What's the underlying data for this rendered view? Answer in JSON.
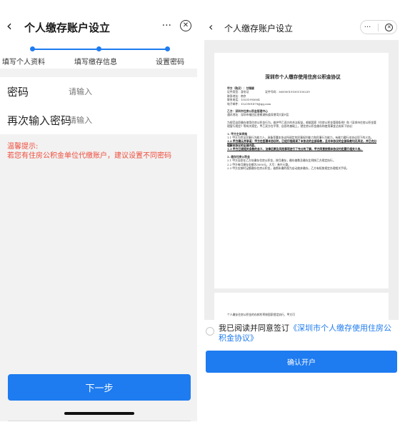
{
  "left": {
    "nav": {
      "back_icon": "‹",
      "title": "个人缴存账户设立",
      "more_icon": "···",
      "close_icon": "✕"
    },
    "steps": [
      "填写个人资料",
      "填写缴存信息",
      "设置密码"
    ],
    "fields": [
      {
        "label": "密码",
        "placeholder": "请输入"
      },
      {
        "label": "再次输入密码",
        "placeholder": "请输入"
      }
    ],
    "tips": {
      "title": "温馨提示:",
      "body": "若您有住房公积金单位代缴账户，建议设置不同密码"
    },
    "next_button": "下一步",
    "colors": {
      "accent": "#1e7bf0",
      "warning": "#ee4d3c"
    }
  },
  "right": {
    "nav": {
      "back_icon": "‹",
      "title": "个人缴存账户设立",
      "more_icon": "···",
      "close_icon": "✕"
    },
    "document": {
      "title": "深圳市个人缴存使用住房公积金协议",
      "party_a": [
        "甲方（购买）：甘精颖",
        "证件类型：身份证　　　　　　证件号码：360000191001150239",
        "联系地址：南京",
        "联系电话：15531993604",
        "电子邮件：1523901879@qq.com"
      ],
      "party_b": [
        "乙方：深圳市住房公积金管理中心",
        "通讯地址：深圳市福田区香蜜湖街道深港湾大厦F层"
      ],
      "intro": "为规范自愿缴存使用住房公积金行为，维护甲乙双方的合法权益，根据国家《住房公积金管理条例》和《深圳市住房公积金管理暂行规定》等有关规定，甲乙双方在平等、自愿的基础上，就住房公积金缴存和使用事宜达成如下协议：",
      "section1": "1. 甲方主体资格",
      "s1_1": "1.1 甲方为完全民事行为能力人，具备签署本协议所规定的民事权利能力和民事行为能力，有能力履行本协议项下的义务。",
      "s1_2": "1.2 甲方确认并承诺：甲方在签署本协议时，已经仔细阅读了本协议的全部条款，且对本协议的全部条款均无异议，并已充分理解本协议的全部内容。",
      "s1_3": "1.3 甲方已就相关条款的含义、法律后果及风险事项进行了充分的了解，甲方同意按照本协议约定履行相关义务。",
      "section2": "2. 缴存住房公积金",
      "s2_1": "2.1 甲方自愿在乙方处缴存住房公积金，按月缴存，缴存基数及缴存比例按乙方规定执行。",
      "s2_2": "2.2 甲方每月缴存金额为3000元，大写：叁仟元整。",
      "s2_3": "2.3 甲方应按时足额缴存住房公积金，逾期未缴的视为自动放弃缴存，乙方有权按规定办理相关手续。",
      "page2_line": "个人缴存住房公积金的存款利率按国家规定执行，甲方可"
    },
    "agreement": {
      "prefix": "我已阅读并同意签订",
      "link": "《深圳市个人缴存使用住房公积金协议》"
    },
    "confirm_button": "确认开户"
  }
}
